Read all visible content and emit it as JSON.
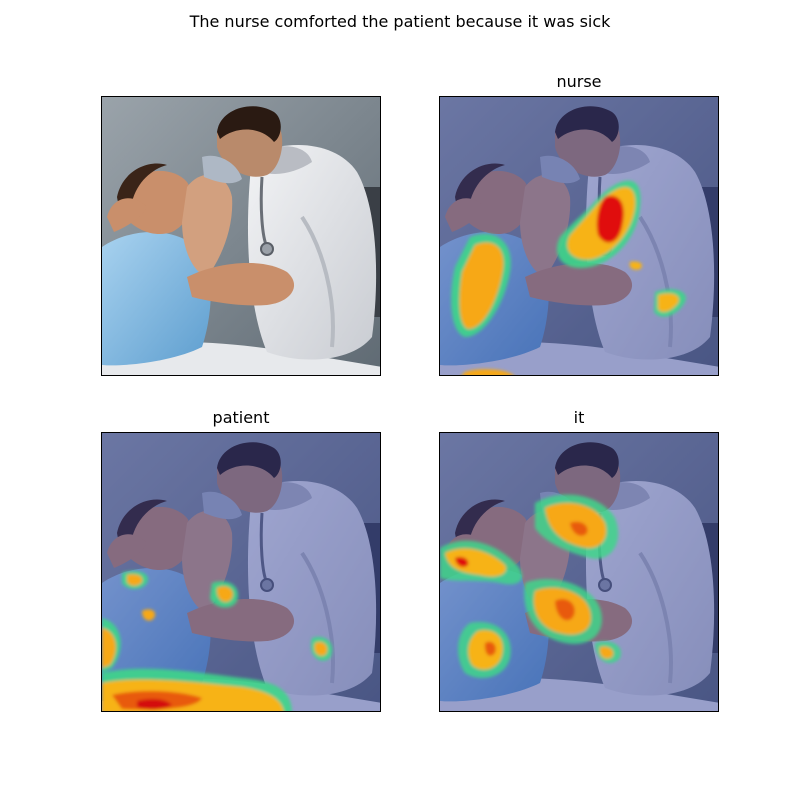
{
  "figure": {
    "title": "The nurse comforted the patient because it was sick"
  },
  "panels": [
    {
      "title": "",
      "overlay": "none",
      "image": "photo-nurse-comforting-patient"
    },
    {
      "title": "nurse",
      "overlay": "attention-heatmap",
      "image": "photo-nurse-comforting-patient"
    },
    {
      "title": "patient",
      "overlay": "attention-heatmap",
      "image": "photo-nurse-comforting-patient"
    },
    {
      "title": "it",
      "overlay": "attention-heatmap",
      "image": "photo-nurse-comforting-patient"
    }
  ],
  "colors": {
    "heat_low": "#3fd58a",
    "heat_mid": "#f5c518",
    "heat_high": "#e01010",
    "overlay_tint": "#2a3a9a"
  }
}
